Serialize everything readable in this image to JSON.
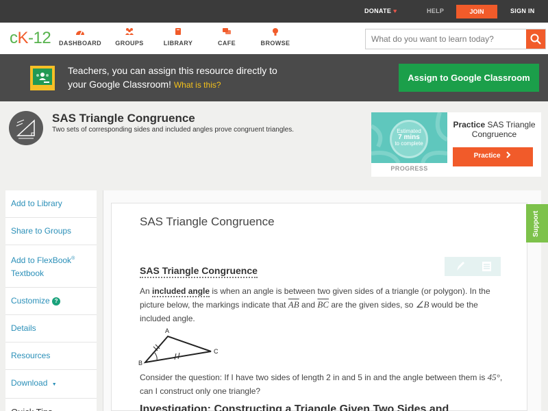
{
  "topbar": {
    "donate": "DONATE",
    "help": "HELP",
    "join": "JOIN",
    "signin": "SIGN IN"
  },
  "nav": {
    "logo_c": "c",
    "logo_k": "K",
    "logo_12": "-12",
    "items": [
      {
        "label": "DASHBOARD",
        "icon": "dashboard-icon"
      },
      {
        "label": "GROUPS",
        "icon": "groups-icon"
      },
      {
        "label": "LIBRARY",
        "icon": "library-icon"
      },
      {
        "label": "CAFE",
        "icon": "cafe-icon"
      },
      {
        "label": "BROWSE",
        "icon": "browse-icon"
      }
    ],
    "search_placeholder": "What do you want to learn today?"
  },
  "classroom": {
    "line1": "Teachers, you can assign this resource directly to",
    "line2": "your Google Classroom!",
    "what": "What is this?",
    "button": "Assign to Google Classroom"
  },
  "concept": {
    "title": "SAS Triangle Congruence",
    "subtitle": "Two sets of corresponding sides and included angles prove congruent triangles."
  },
  "practice": {
    "estimated": "Estimated",
    "mins": "7 mins",
    "to_complete": "to complete",
    "progress_label": "PROGRESS",
    "title_bold": "Practice",
    "title_rest": "SAS Triangle Congruence",
    "button": "Practice"
  },
  "sidebar": {
    "items": [
      "Add to Library",
      "Share to Groups",
      "Add to FlexBook",
      "Customize",
      "Details",
      "Resources",
      "Download",
      "Quick Tips"
    ],
    "flexbook_sup": "®",
    "flexbook_line2": "Textbook",
    "customize_help": "?",
    "download_caret": "▼"
  },
  "article": {
    "title": "SAS Triangle Congruence",
    "section_heading": "SAS Triangle Congruence",
    "p1_a": "An",
    "p1_term": "included angle",
    "p1_b": "is when an angle is between two given sides of a triangle (or polygon). In the picture below, the markings indicate that",
    "p1_ab": "AB",
    "p1_and": "and",
    "p1_bc": "BC",
    "p1_c": "are the given sides, so",
    "p1_angle": "∠B",
    "p1_d": "would be the included angle.",
    "diagram_labels": {
      "a": "A",
      "b": "B",
      "c": "C"
    },
    "p2_a": "Consider the question: If I have two sides of length 2 in and 5 in and the angle between them is",
    "p2_deg": "45°",
    "p2_b": ", can I construct only one triangle?",
    "next_heading": "Investigation: Constructing a Triangle Given Two Sides and"
  },
  "support": "Support",
  "colors": {
    "brand_orange": "#f15b2a",
    "brand_green": "#56b24c",
    "classroom_green": "#1b9f4a",
    "link_blue": "#2a8fb8"
  }
}
